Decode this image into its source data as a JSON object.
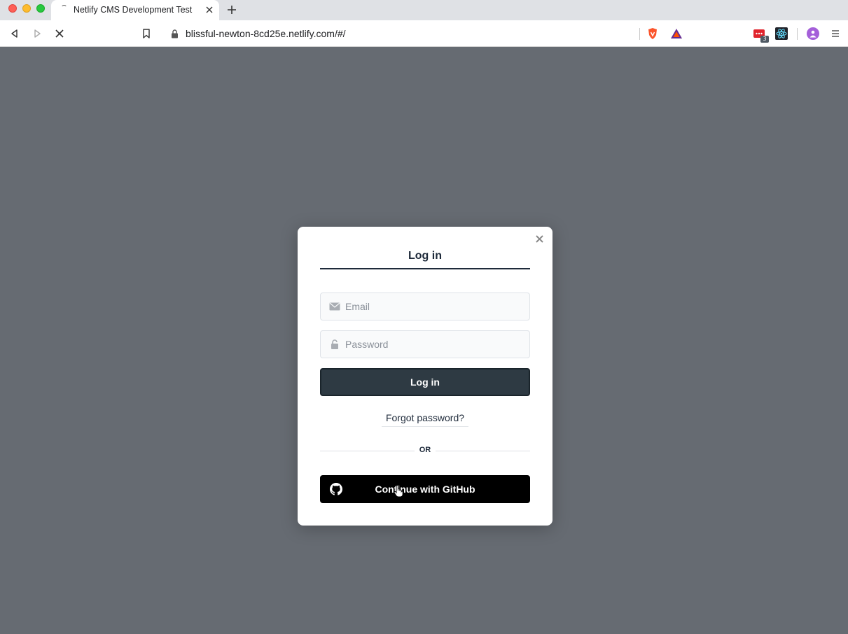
{
  "browser": {
    "tab_title": "Netlify CMS Development Test",
    "url": "blissful-newton-8cd25e.netlify.com/#/",
    "extension_badge_count": "3",
    "icons": [
      "back-icon",
      "forward-icon",
      "stop-icon",
      "bookmark-icon",
      "lock-icon",
      "brave-shields-icon",
      "brave-rewards-icon",
      "extension-icon",
      "react-devtools-icon",
      "profile-avatar",
      "menu-icon"
    ]
  },
  "modal": {
    "tab_label": "Log in",
    "email_placeholder": "Email",
    "password_placeholder": "Password",
    "login_button": "Log in",
    "forgot_password": "Forgot password?",
    "divider_text": "OR",
    "github_button": "Continue with GitHub"
  },
  "colors": {
    "overlay": "#666b72",
    "primary_button": "#2e3a43",
    "github_button": "#000000"
  }
}
